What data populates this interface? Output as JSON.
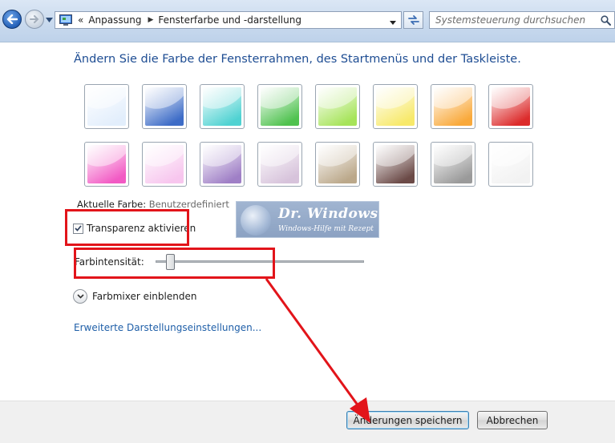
{
  "address_bar": {
    "overflow_chevron": "«",
    "breadcrumb": [
      "Anpassung",
      "Fensterfarbe und -darstellung"
    ],
    "search_placeholder": "Systemsteuerung durchsuchen"
  },
  "heading": "Ändern Sie die Farbe der Fensterrahmen, des Startmenüs und der Taskleiste.",
  "swatches": [
    {
      "name": "sky",
      "color": "#e2eefc"
    },
    {
      "name": "twilight",
      "color": "#3d6cc7"
    },
    {
      "name": "sea",
      "color": "#4fd2d2"
    },
    {
      "name": "leaf",
      "color": "#4fc24f"
    },
    {
      "name": "lime",
      "color": "#a6e45a"
    },
    {
      "name": "lemon",
      "color": "#f7e96a"
    },
    {
      "name": "pumpkin",
      "color": "#f9a93b"
    },
    {
      "name": "ruby",
      "color": "#dc2b2b"
    },
    {
      "name": "fuchsia",
      "color": "#f25ac4"
    },
    {
      "name": "blush",
      "color": "#f7c6ee"
    },
    {
      "name": "violet",
      "color": "#9f7fc6"
    },
    {
      "name": "lavender",
      "color": "#d7c3db"
    },
    {
      "name": "taupe",
      "color": "#bba88a"
    },
    {
      "name": "chocolate",
      "color": "#6b4a47"
    },
    {
      "name": "slate",
      "color": "#9a9a9a"
    },
    {
      "name": "frost",
      "color": "#f2f2f2"
    }
  ],
  "current_color": {
    "label": "Aktuelle Farbe:",
    "value": "Benutzerdefiniert"
  },
  "transparency": {
    "label": "Transparenz aktivieren",
    "checked": true
  },
  "intensity": {
    "label": "Farbintensität:",
    "value_fraction": 0.07
  },
  "mixer_label": "Farbmixer einblenden",
  "advanced_link": "Erweiterte Darstellungseinstellungen...",
  "watermark": {
    "title": "Dr. Windows",
    "subtitle": "Windows-Hilfe mit Rezept"
  },
  "buttons": {
    "save": "Änderungen speichern",
    "cancel": "Abbrechen"
  },
  "colors": {
    "annotation": "#e2141a",
    "link": "#1f5fa8",
    "heading": "#1e4d93"
  }
}
